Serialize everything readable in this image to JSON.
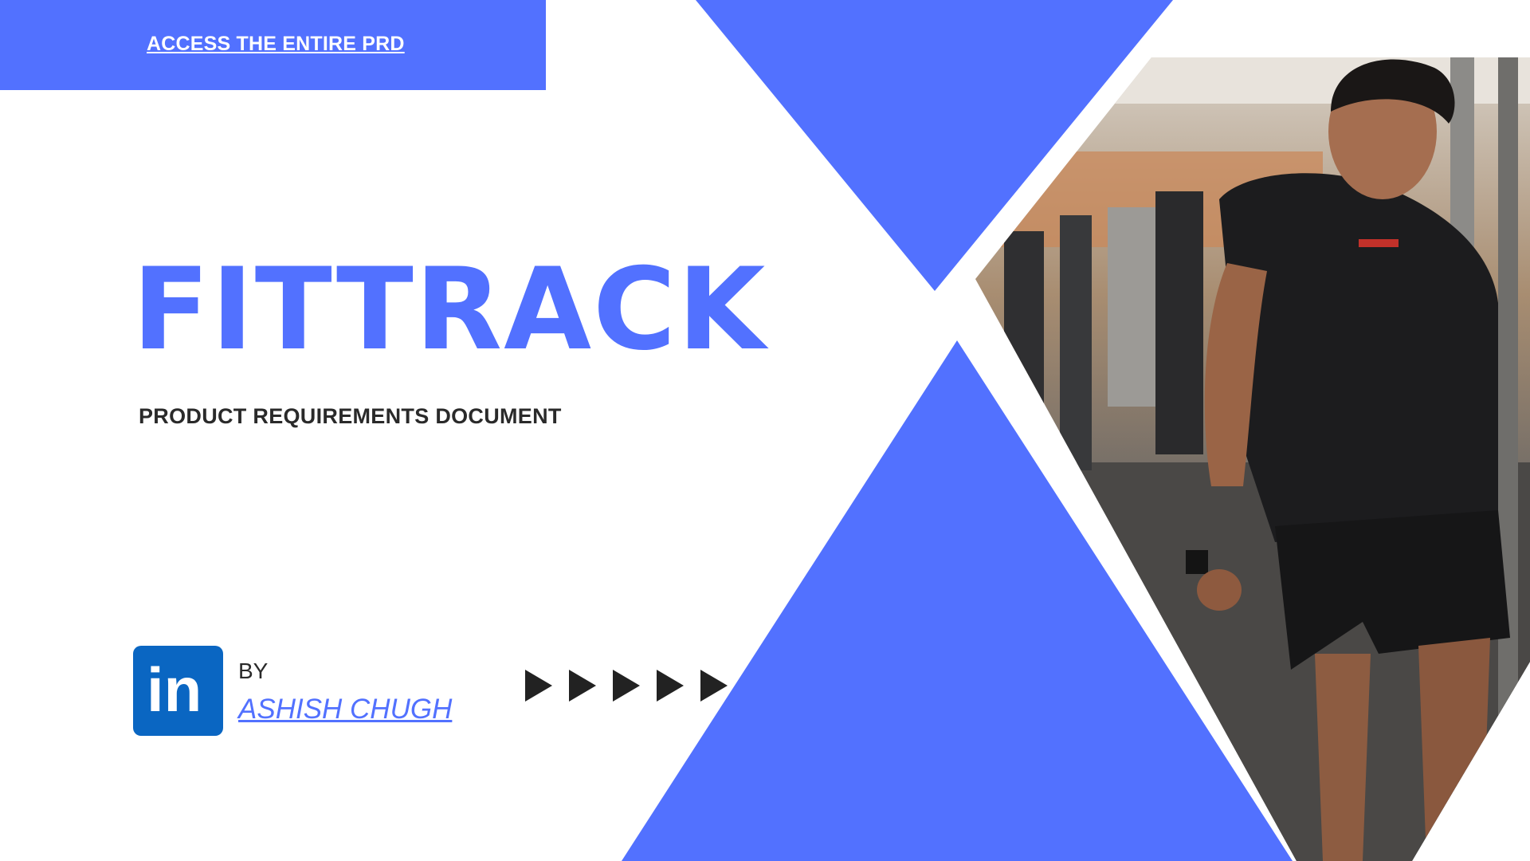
{
  "banner": {
    "link_label": "ACCESS THE ENTIRE PRD"
  },
  "hero": {
    "title": "FITTRACK",
    "subtitle": "PRODUCT REQUIREMENTS DOCUMENT"
  },
  "author": {
    "by_label": "BY",
    "name": "ASHISH CHUGH",
    "linkedin_icon": "linkedin-icon",
    "linkedin_glyph": "in"
  },
  "decor": {
    "arrow_icon": "play-arrow-icon",
    "arrow_count": 5
  },
  "photo": {
    "description_icon": "gym-photo"
  },
  "colors": {
    "accent": "#5271ff",
    "linkedin": "#0a66c2",
    "text_dark": "#2a2a2a",
    "background": "#ffffff"
  }
}
